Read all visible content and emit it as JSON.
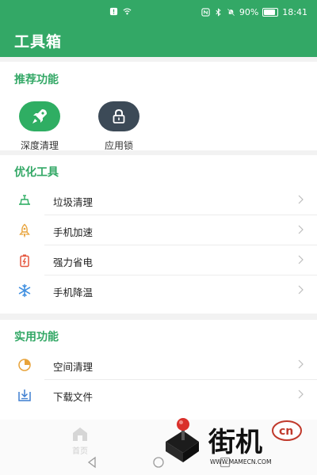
{
  "status_bar": {
    "battery_text": "90%",
    "time": "18:41",
    "battery_level": 0.9
  },
  "header": {
    "title": "工具箱"
  },
  "recommend": {
    "title": "推荐功能",
    "items": [
      {
        "label": "深度清理",
        "icon": "rocket-icon",
        "color": "#2fae63"
      },
      {
        "label": "应用锁",
        "icon": "lock-icon",
        "color": "#3c4a57"
      }
    ]
  },
  "optimize": {
    "title": "优化工具",
    "items": [
      {
        "label": "垃圾清理",
        "icon": "trash-tray-icon",
        "color": "#2fae63"
      },
      {
        "label": "手机加速",
        "icon": "rocket-launch-icon",
        "color": "#e8a33a"
      },
      {
        "label": "强力省电",
        "icon": "battery-power-icon",
        "color": "#e5573f"
      },
      {
        "label": "手机降温",
        "icon": "snowflake-icon",
        "color": "#3f8fe0"
      }
    ]
  },
  "utility": {
    "title": "实用功能",
    "items": [
      {
        "label": "空间清理",
        "icon": "pie-chart-icon",
        "color": "#e8a33a"
      },
      {
        "label": "下载文件",
        "icon": "download-icon",
        "color": "#3f7fd0"
      }
    ]
  },
  "bottom_tab": {
    "home_label": "首页"
  },
  "watermark": {
    "site": "WWW.MAMECN.COM",
    "brand": "街机",
    "suffix": "cn"
  }
}
